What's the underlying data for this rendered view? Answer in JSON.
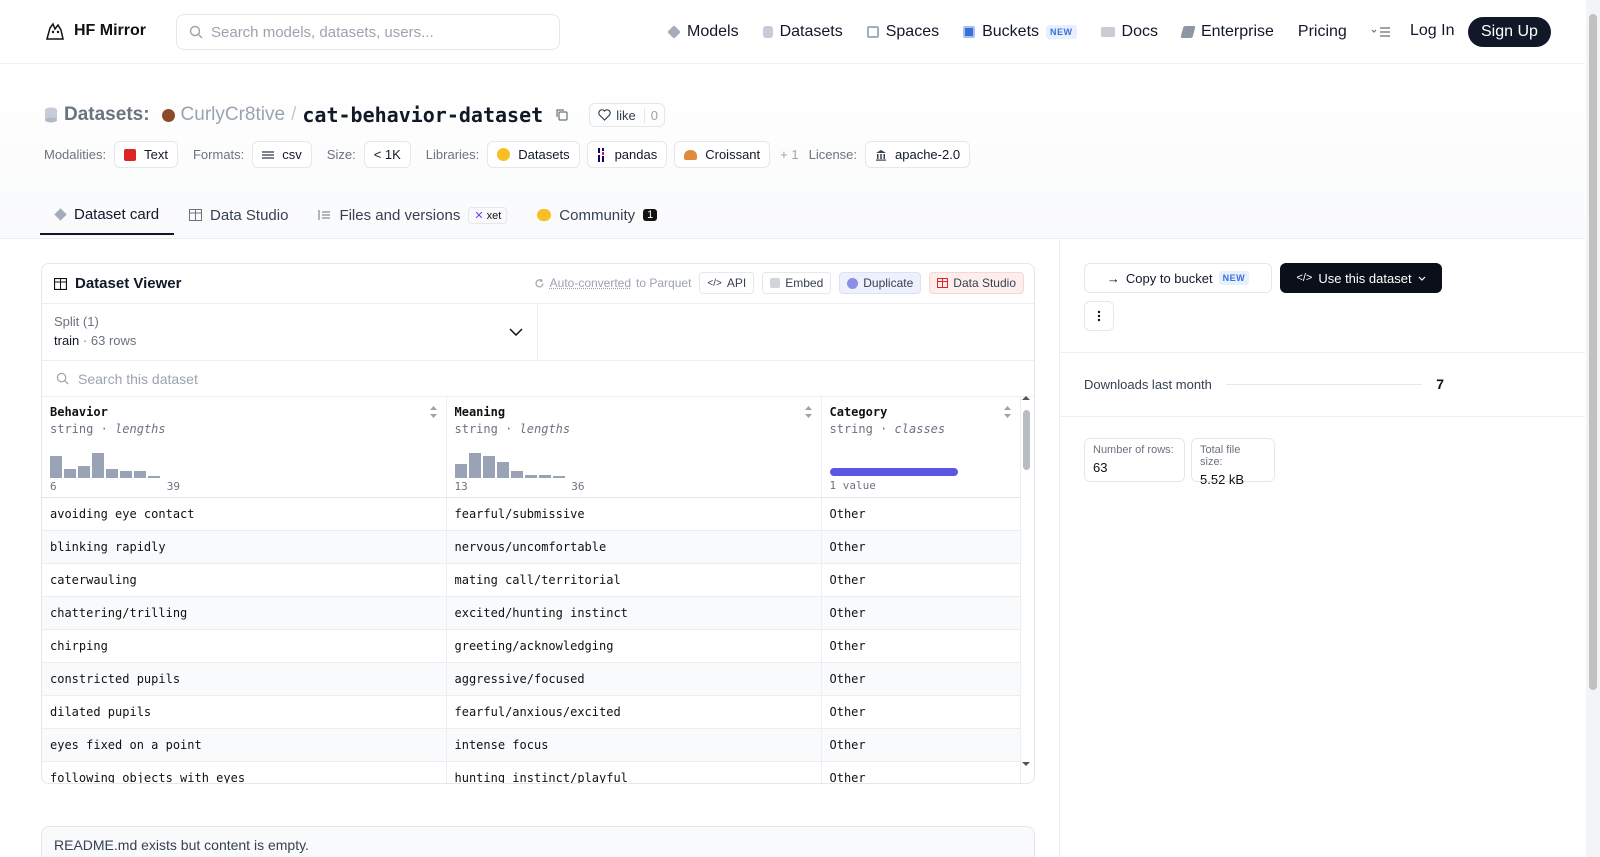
{
  "nav": {
    "brand": "HF Mirror",
    "search_placeholder": "Search models, datasets, users...",
    "links": [
      "Models",
      "Datasets",
      "Spaces",
      "Buckets",
      "Docs",
      "Enterprise",
      "Pricing"
    ],
    "buckets_badge": "NEW",
    "login": "Log In",
    "signup": "Sign Up"
  },
  "header": {
    "section_label": "Datasets:",
    "owner": "CurlyCr8tive",
    "separator": "/",
    "dataset_name": "cat-behavior-dataset",
    "like_label": "like",
    "like_count": "0",
    "meta": {
      "modalities_label": "Modalities:",
      "modalities": [
        "Text"
      ],
      "formats_label": "Formats:",
      "formats": [
        "csv"
      ],
      "size_label": "Size:",
      "size": "< 1K",
      "libraries_label": "Libraries:",
      "libraries": [
        "Datasets",
        "pandas",
        "Croissant"
      ],
      "libraries_more": "+ 1",
      "license_label": "License:",
      "license": "apache-2.0"
    },
    "tabs": {
      "dataset_card": "Dataset card",
      "data_studio": "Data Studio",
      "files": "Files and versions",
      "files_badge": "xet",
      "community": "Community",
      "community_count": "1"
    }
  },
  "viewer": {
    "title": "Dataset Viewer",
    "auto_converted": "Auto-converted",
    "auto_suffix": "to Parquet",
    "actions": [
      "API",
      "Embed",
      "Duplicate",
      "Data Studio"
    ],
    "split_label": "Split (1)",
    "split_value": "train",
    "split_rows": "63 rows",
    "search_placeholder": "Search this dataset",
    "columns": [
      {
        "name": "Behavior",
        "type": "string",
        "stat": "lengths",
        "min": "6",
        "max": "39",
        "hist": [
          0.85,
          0.35,
          0.45,
          0.95,
          0.35,
          0.28,
          0.28,
          0.08
        ]
      },
      {
        "name": "Meaning",
        "type": "string",
        "stat": "lengths",
        "min": "13",
        "max": "36",
        "hist": [
          0.55,
          0.95,
          0.85,
          0.6,
          0.28,
          0.1,
          0.1,
          0.08
        ]
      },
      {
        "name": "Category",
        "type": "string",
        "stat": "classes",
        "class_label": "1 value"
      }
    ],
    "rows": [
      [
        "avoiding eye contact",
        "fearful/submissive",
        "Other"
      ],
      [
        "blinking rapidly",
        "nervous/uncomfortable",
        "Other"
      ],
      [
        "caterwauling",
        "mating call/territorial",
        "Other"
      ],
      [
        "chattering/trilling",
        "excited/hunting instinct",
        "Other"
      ],
      [
        "chirping",
        "greeting/acknowledging",
        "Other"
      ],
      [
        "constricted pupils",
        "aggressive/focused",
        "Other"
      ],
      [
        "dilated pupils",
        "fearful/anxious/excited",
        "Other"
      ],
      [
        "eyes fixed on a point",
        "intense focus",
        "Other"
      ],
      [
        "following objects with eyes",
        "hunting instinct/playful",
        "Other"
      ]
    ]
  },
  "readme_text": "README.md exists but content is empty.",
  "sidebar": {
    "copy_bucket": "Copy to bucket",
    "copy_badge": "NEW",
    "use_dataset": "Use this dataset",
    "downloads_label": "Downloads last month",
    "downloads_value": "7",
    "rows_label": "Number of rows:",
    "rows_value": "63",
    "size_label": "Total file size:",
    "size_value": "5.52 kB"
  },
  "colors": {
    "accent_dark": "#111827",
    "class_bar": "#5b57e0",
    "hist_bar": "#9aa3b5"
  }
}
